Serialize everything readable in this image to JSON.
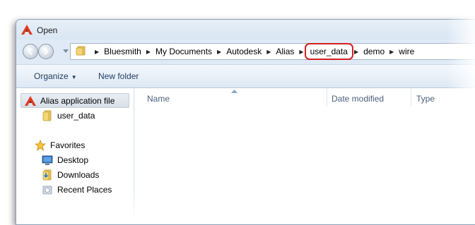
{
  "window": {
    "title": "Open"
  },
  "address_bar": {
    "crumbs": [
      "Bluesmith",
      "My Documents",
      "Autodesk",
      "Alias",
      "user_data",
      "demo",
      "wire"
    ],
    "highlighted": "user_data"
  },
  "toolbar": {
    "organize_label": "Organize",
    "new_folder_label": "New folder"
  },
  "nav_pane": {
    "items": [
      {
        "label": "Alias application file",
        "icon": "alias-icon",
        "selected": true
      },
      {
        "label": "user_data",
        "icon": "folder-icon"
      },
      {
        "label": "Favorites",
        "icon": "star-icon"
      },
      {
        "label": "Desktop",
        "icon": "desktop-icon"
      },
      {
        "label": "Downloads",
        "icon": "downloads-icon"
      },
      {
        "label": "Recent Places",
        "icon": "recent-places-icon"
      }
    ]
  },
  "columns": [
    "Name",
    "Date modified",
    "Type"
  ],
  "colors": {
    "highlight": "#d42020",
    "accent": "#1e3d5f"
  }
}
